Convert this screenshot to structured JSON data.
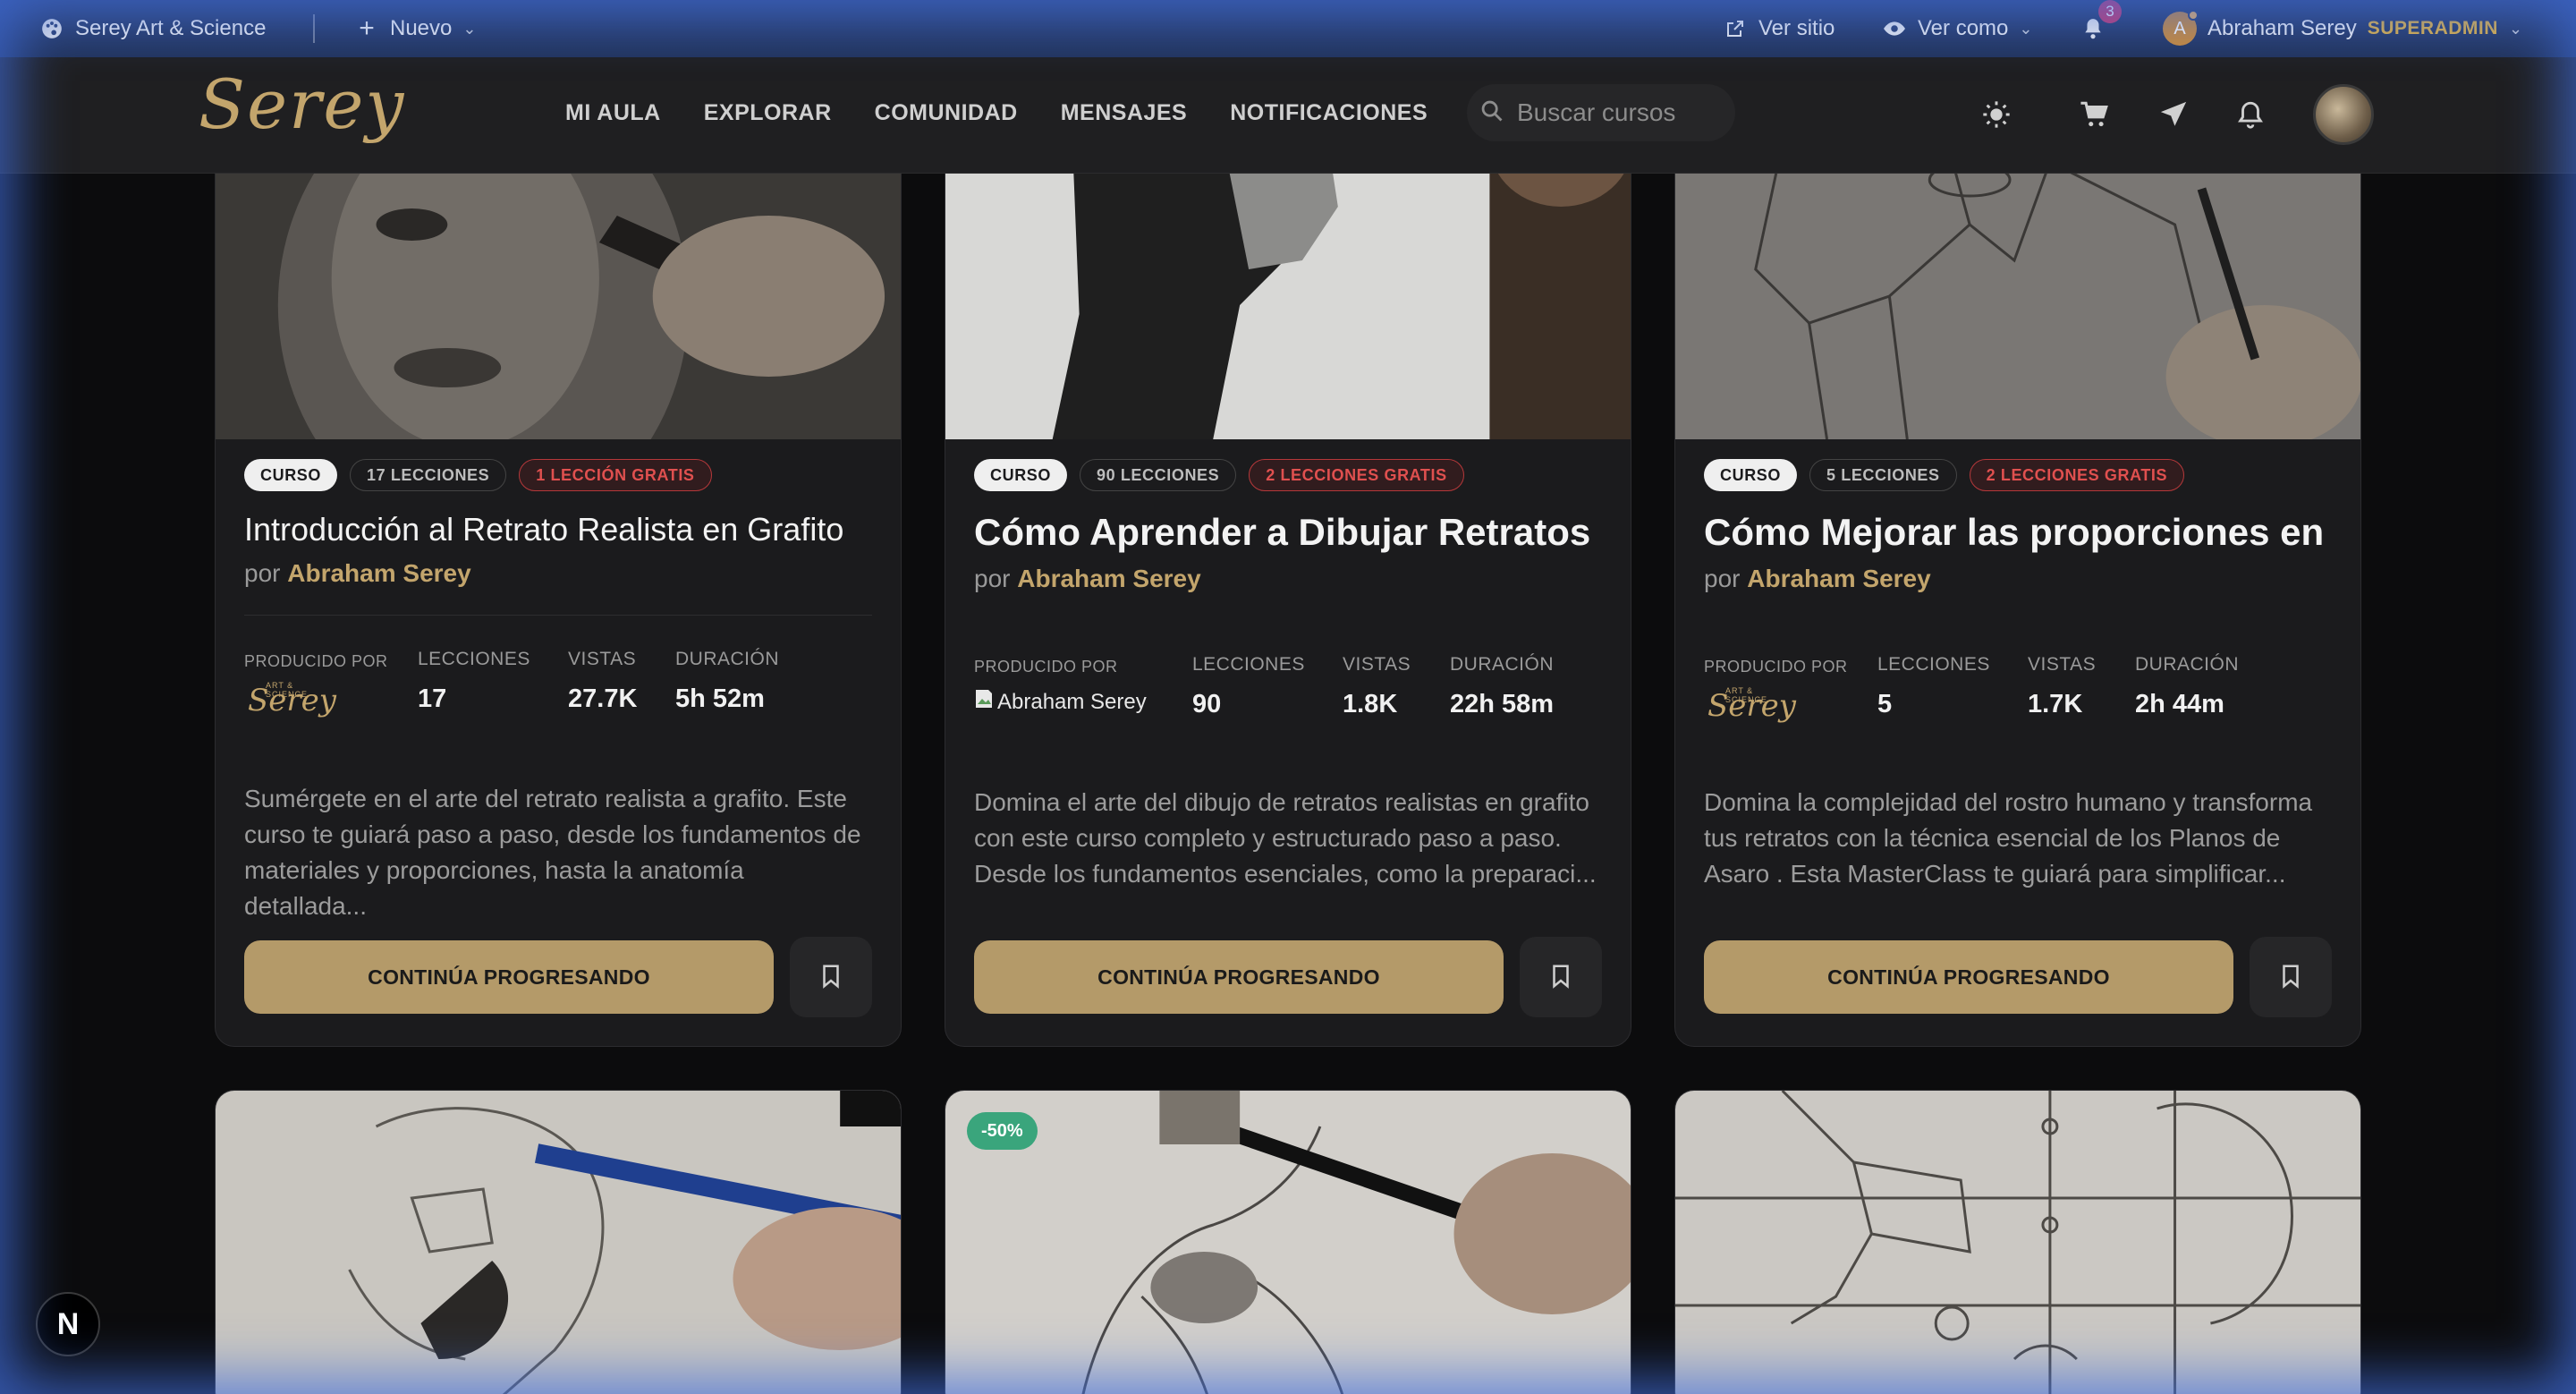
{
  "adminbar": {
    "site_name": "Serey Art & Science",
    "new_label": "Nuevo",
    "view_site": "Ver sitio",
    "view_as": "Ver como",
    "notif_count": "3",
    "avatar_letter": "A",
    "user_name": "Abraham Serey",
    "role": "SUPERADMIN"
  },
  "header": {
    "logo": "Serey",
    "nav": [
      "MI AULA",
      "EXPLORAR",
      "COMUNIDAD",
      "MENSAJES",
      "NOTIFICACIONES"
    ],
    "search_placeholder": "Buscar cursos"
  },
  "labels": {
    "by": "por",
    "produced_by": "PRODUCIDO POR",
    "lessons": "LECCIONES",
    "views": "VISTAS",
    "duration": "DURACIÓN",
    "continue": "CONTINÚA PROGRESANDO",
    "mini_logo_tag": "ART & SCIENCE",
    "mini_logo": "Serey"
  },
  "courses": [
    {
      "type": "CURSO",
      "lessons_pill": "17 LECCIONES",
      "free_pill": "1 LECCIÓN GRATIS",
      "title": "Introducción al Retrato Realista en Grafito",
      "author": "Abraham Serey",
      "lessons": "17",
      "views": "27.7K",
      "duration": "5h 52m",
      "description": "Sumérgete en el arte del retrato realista a grafito. Este curso te guiará paso a paso, desde los fundamentos de materiales y proporciones, hasta la anatomía detallada..."
    },
    {
      "type": "CURSO",
      "lessons_pill": "90 LECCIONES",
      "free_pill": "2 LECCIONES GRATIS",
      "title": "Cómo Aprender a Dibujar Retratos R...",
      "author": "Abraham Serey",
      "producer": "Abraham Serey",
      "lessons": "90",
      "views": "1.8K",
      "duration": "22h 58m",
      "description": "Domina el arte del dibujo de retratos realistas en grafito con este curso completo y estructurado paso a paso. Desde los fundamentos esenciales, como la preparaci..."
    },
    {
      "type": "CURSO",
      "lessons_pill": "5 LECCIONES",
      "free_pill": "2 LECCIONES GRATIS",
      "title": "Cómo Mejorar las proporciones en e...",
      "author": "Abraham Serey",
      "lessons": "5",
      "views": "1.7K",
      "duration": "2h 44m",
      "description": "Domina la complejidad del rostro humano y transforma tus retratos con la técnica esencial de los Planos de Asaro . Esta MasterClass te guiará para simplificar..."
    }
  ],
  "discount_badge": "-50%",
  "next_badge": "N",
  "colors": {
    "accent": "#b49a69",
    "admin_bar": "#2b3f6e",
    "free_pill": "#e0504f",
    "discount": "#3aa57c"
  }
}
